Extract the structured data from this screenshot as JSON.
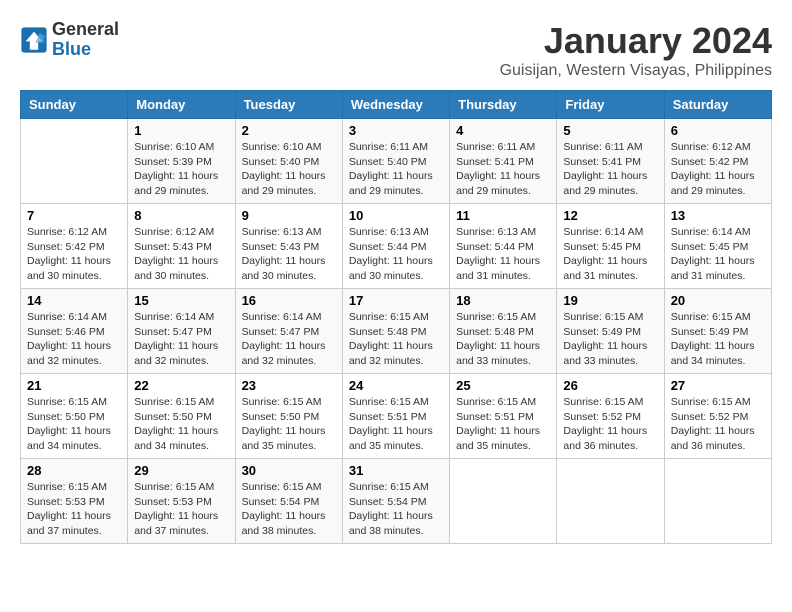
{
  "logo": {
    "text_general": "General",
    "text_blue": "Blue"
  },
  "header": {
    "title": "January 2024",
    "subtitle": "Guisijan, Western Visayas, Philippines"
  },
  "days_of_week": [
    "Sunday",
    "Monday",
    "Tuesday",
    "Wednesday",
    "Thursday",
    "Friday",
    "Saturday"
  ],
  "weeks": [
    [
      {
        "day": "",
        "info": ""
      },
      {
        "day": "1",
        "info": "Sunrise: 6:10 AM\nSunset: 5:39 PM\nDaylight: 11 hours\nand 29 minutes."
      },
      {
        "day": "2",
        "info": "Sunrise: 6:10 AM\nSunset: 5:40 PM\nDaylight: 11 hours\nand 29 minutes."
      },
      {
        "day": "3",
        "info": "Sunrise: 6:11 AM\nSunset: 5:40 PM\nDaylight: 11 hours\nand 29 minutes."
      },
      {
        "day": "4",
        "info": "Sunrise: 6:11 AM\nSunset: 5:41 PM\nDaylight: 11 hours\nand 29 minutes."
      },
      {
        "day": "5",
        "info": "Sunrise: 6:11 AM\nSunset: 5:41 PM\nDaylight: 11 hours\nand 29 minutes."
      },
      {
        "day": "6",
        "info": "Sunrise: 6:12 AM\nSunset: 5:42 PM\nDaylight: 11 hours\nand 29 minutes."
      }
    ],
    [
      {
        "day": "7",
        "info": "Sunrise: 6:12 AM\nSunset: 5:42 PM\nDaylight: 11 hours\nand 30 minutes."
      },
      {
        "day": "8",
        "info": "Sunrise: 6:12 AM\nSunset: 5:43 PM\nDaylight: 11 hours\nand 30 minutes."
      },
      {
        "day": "9",
        "info": "Sunrise: 6:13 AM\nSunset: 5:43 PM\nDaylight: 11 hours\nand 30 minutes."
      },
      {
        "day": "10",
        "info": "Sunrise: 6:13 AM\nSunset: 5:44 PM\nDaylight: 11 hours\nand 30 minutes."
      },
      {
        "day": "11",
        "info": "Sunrise: 6:13 AM\nSunset: 5:44 PM\nDaylight: 11 hours\nand 31 minutes."
      },
      {
        "day": "12",
        "info": "Sunrise: 6:14 AM\nSunset: 5:45 PM\nDaylight: 11 hours\nand 31 minutes."
      },
      {
        "day": "13",
        "info": "Sunrise: 6:14 AM\nSunset: 5:45 PM\nDaylight: 11 hours\nand 31 minutes."
      }
    ],
    [
      {
        "day": "14",
        "info": "Sunrise: 6:14 AM\nSunset: 5:46 PM\nDaylight: 11 hours\nand 32 minutes."
      },
      {
        "day": "15",
        "info": "Sunrise: 6:14 AM\nSunset: 5:47 PM\nDaylight: 11 hours\nand 32 minutes."
      },
      {
        "day": "16",
        "info": "Sunrise: 6:14 AM\nSunset: 5:47 PM\nDaylight: 11 hours\nand 32 minutes."
      },
      {
        "day": "17",
        "info": "Sunrise: 6:15 AM\nSunset: 5:48 PM\nDaylight: 11 hours\nand 32 minutes."
      },
      {
        "day": "18",
        "info": "Sunrise: 6:15 AM\nSunset: 5:48 PM\nDaylight: 11 hours\nand 33 minutes."
      },
      {
        "day": "19",
        "info": "Sunrise: 6:15 AM\nSunset: 5:49 PM\nDaylight: 11 hours\nand 33 minutes."
      },
      {
        "day": "20",
        "info": "Sunrise: 6:15 AM\nSunset: 5:49 PM\nDaylight: 11 hours\nand 34 minutes."
      }
    ],
    [
      {
        "day": "21",
        "info": "Sunrise: 6:15 AM\nSunset: 5:50 PM\nDaylight: 11 hours\nand 34 minutes."
      },
      {
        "day": "22",
        "info": "Sunrise: 6:15 AM\nSunset: 5:50 PM\nDaylight: 11 hours\nand 34 minutes."
      },
      {
        "day": "23",
        "info": "Sunrise: 6:15 AM\nSunset: 5:50 PM\nDaylight: 11 hours\nand 35 minutes."
      },
      {
        "day": "24",
        "info": "Sunrise: 6:15 AM\nSunset: 5:51 PM\nDaylight: 11 hours\nand 35 minutes."
      },
      {
        "day": "25",
        "info": "Sunrise: 6:15 AM\nSunset: 5:51 PM\nDaylight: 11 hours\nand 35 minutes."
      },
      {
        "day": "26",
        "info": "Sunrise: 6:15 AM\nSunset: 5:52 PM\nDaylight: 11 hours\nand 36 minutes."
      },
      {
        "day": "27",
        "info": "Sunrise: 6:15 AM\nSunset: 5:52 PM\nDaylight: 11 hours\nand 36 minutes."
      }
    ],
    [
      {
        "day": "28",
        "info": "Sunrise: 6:15 AM\nSunset: 5:53 PM\nDaylight: 11 hours\nand 37 minutes."
      },
      {
        "day": "29",
        "info": "Sunrise: 6:15 AM\nSunset: 5:53 PM\nDaylight: 11 hours\nand 37 minutes."
      },
      {
        "day": "30",
        "info": "Sunrise: 6:15 AM\nSunset: 5:54 PM\nDaylight: 11 hours\nand 38 minutes."
      },
      {
        "day": "31",
        "info": "Sunrise: 6:15 AM\nSunset: 5:54 PM\nDaylight: 11 hours\nand 38 minutes."
      },
      {
        "day": "",
        "info": ""
      },
      {
        "day": "",
        "info": ""
      },
      {
        "day": "",
        "info": ""
      }
    ]
  ]
}
